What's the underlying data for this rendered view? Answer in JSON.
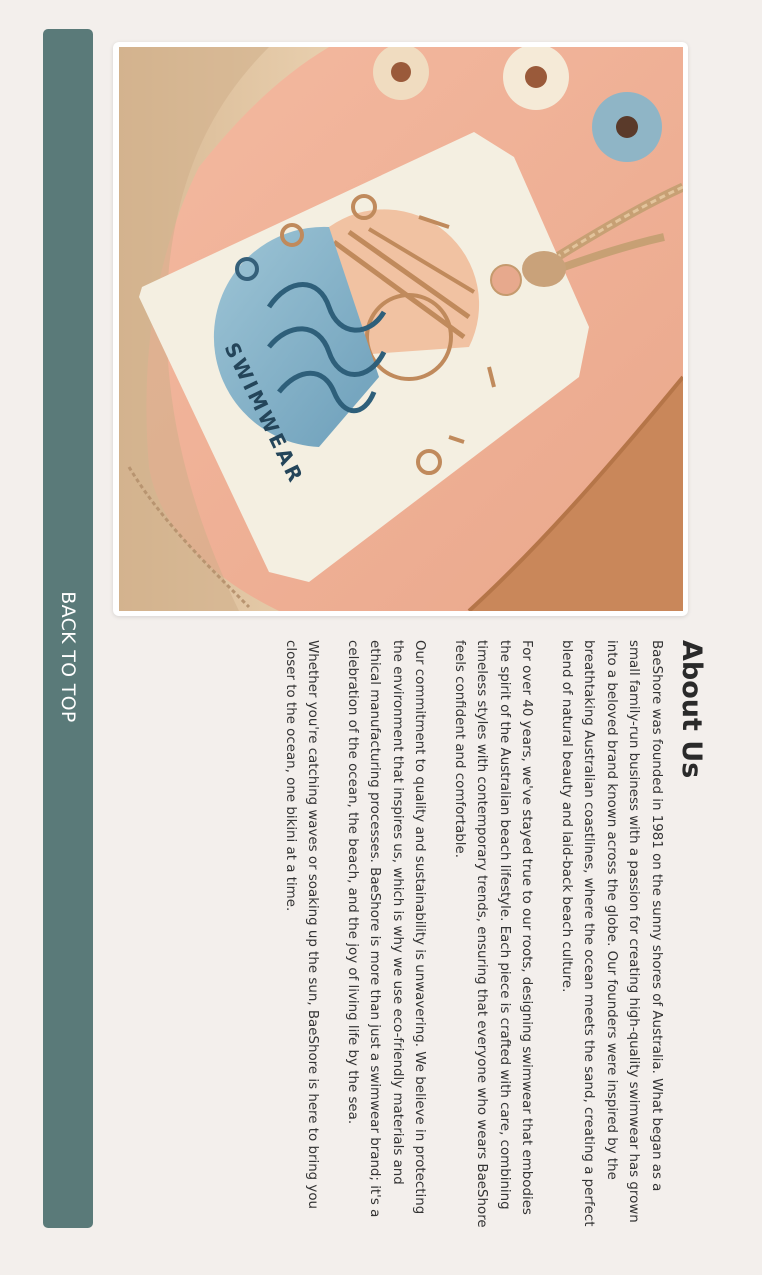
{
  "nav": {
    "back_to_top_label": "BACK TO TOP"
  },
  "hero": {
    "tag_text": "SWIMWEAR"
  },
  "about": {
    "title": "About Us",
    "paragraphs": [
      "BaeShore was founded in 1981 on the sunny shores of Australia. What began as a small family-run business with a passion for creating high-quality swimwear has grown into a beloved brand known across the globe. Our founders were inspired by the breathtaking Australian coastlines, where the ocean meets the sand, creating a perfect blend of natural beauty and laid-back beach culture.",
      "For over 40 years, we've stayed true to our roots, designing swimwear that embodies the spirit of the Australian beach lifestyle. Each piece is crafted with care, combining timeless styles with contemporary trends, ensuring that everyone who wears BaeShore feels confident and comfortable.",
      "Our commitment to quality and sustainability is unwavering. We believe in protecting the environment that inspires us, which is why we use eco-friendly materials and ethical manufacturing processes. BaeShore is more than just a swimwear brand; it's a celebration of the ocean, the beach, and the joy of living life by the sea.",
      "Whether you're catching waves or soaking up the sun, BaeShore is here to bring you closer to the ocean, one bikini at a time."
    ]
  },
  "colors": {
    "page_background": "#f3efec",
    "back_to_top_bg": "#5a7a79",
    "text": "#333333"
  }
}
